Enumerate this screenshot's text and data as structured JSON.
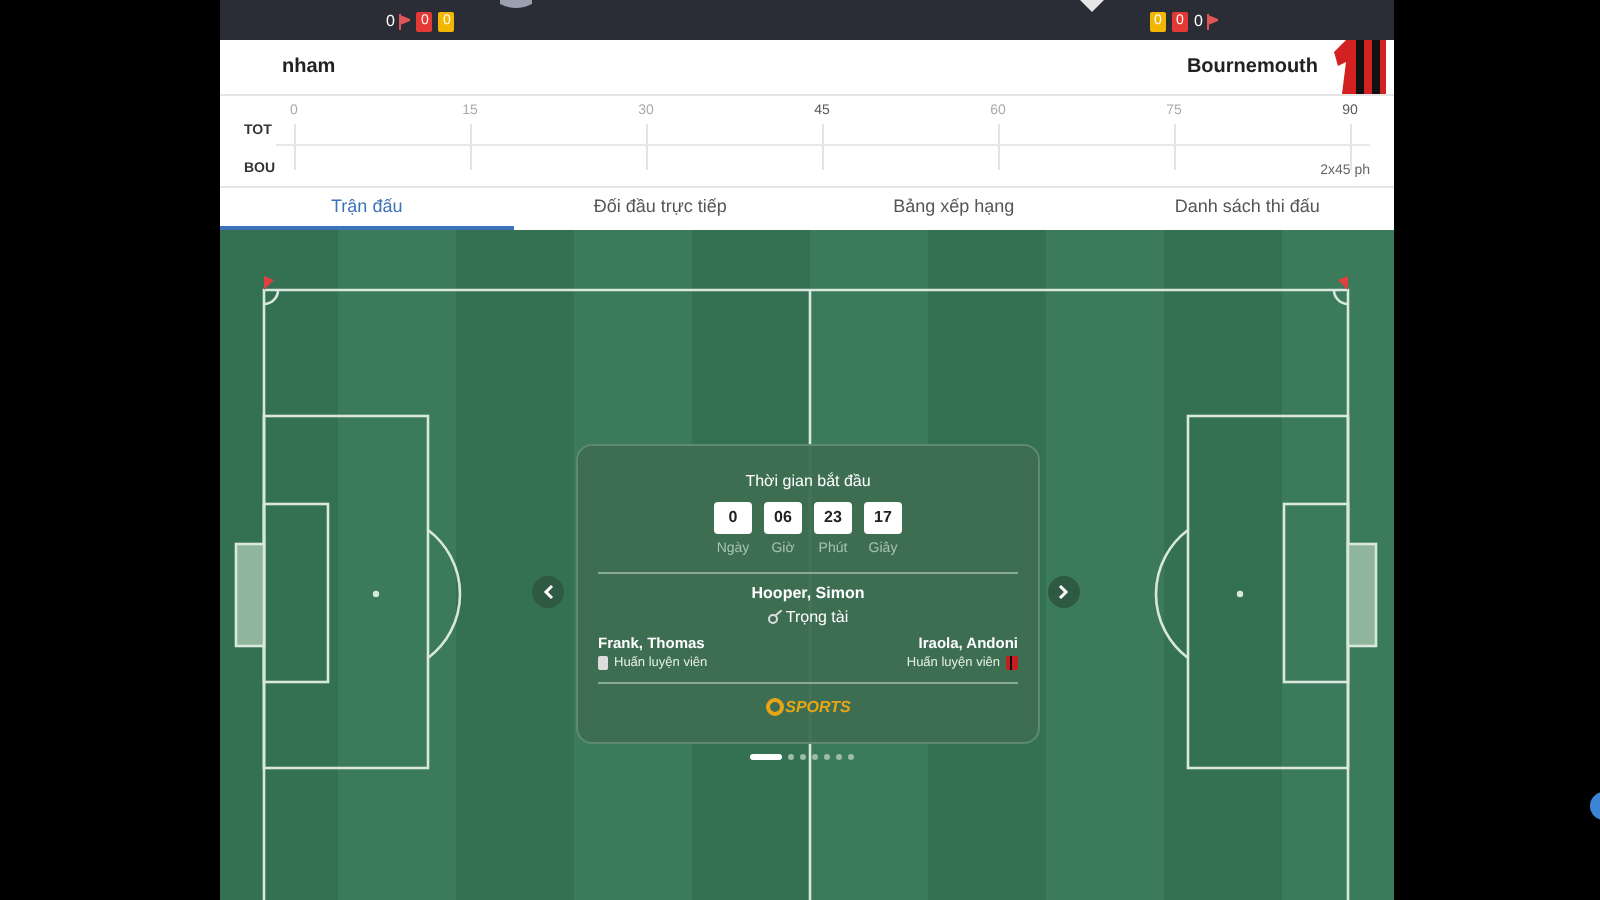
{
  "top_bar": {
    "home_stats": [
      {
        "kind": "corner",
        "value": "0"
      },
      {
        "kind": "red",
        "value": "0"
      },
      {
        "kind": "yellow",
        "value": "0"
      }
    ],
    "away_stats": [
      {
        "kind": "yellow",
        "value": "0"
      },
      {
        "kind": "red",
        "value": "0"
      },
      {
        "kind": "corner",
        "value": "0"
      }
    ]
  },
  "teams": {
    "home": "nham",
    "away": "Bournemouth"
  },
  "timeline": {
    "rows": [
      "TOT",
      "BOU"
    ],
    "ticks": [
      "0",
      "15",
      "30",
      "45",
      "60",
      "75",
      "90"
    ],
    "duration": "2x45 ph"
  },
  "tabs": [
    {
      "label": "Trận đấu",
      "selected": true
    },
    {
      "label": "Đối đầu trực tiếp",
      "selected": false
    },
    {
      "label": "Bảng xếp hạng",
      "selected": false
    },
    {
      "label": "Danh sách thi đấu",
      "selected": false
    }
  ],
  "match_card": {
    "title": "Thời gian bắt đầu",
    "countdown": [
      {
        "value": "0",
        "label": "Ngày"
      },
      {
        "value": "06",
        "label": "Giờ"
      },
      {
        "value": "23",
        "label": "Phút"
      },
      {
        "value": "17",
        "label": "Giây"
      }
    ],
    "referee": {
      "name": "Hooper, Simon",
      "role": "Trọng tài"
    },
    "home_coach": {
      "name": "Frank, Thomas",
      "role": "Huấn luyện viên"
    },
    "away_coach": {
      "name": "Iraola, Andoni",
      "role": "Huấn luyện viên"
    },
    "brand": "SPORTS"
  },
  "carousel": [
    {
      "selected": true
    },
    {
      "selected": false
    },
    {
      "selected": false
    },
    {
      "selected": false
    },
    {
      "selected": false
    },
    {
      "selected": false
    },
    {
      "selected": false
    }
  ]
}
